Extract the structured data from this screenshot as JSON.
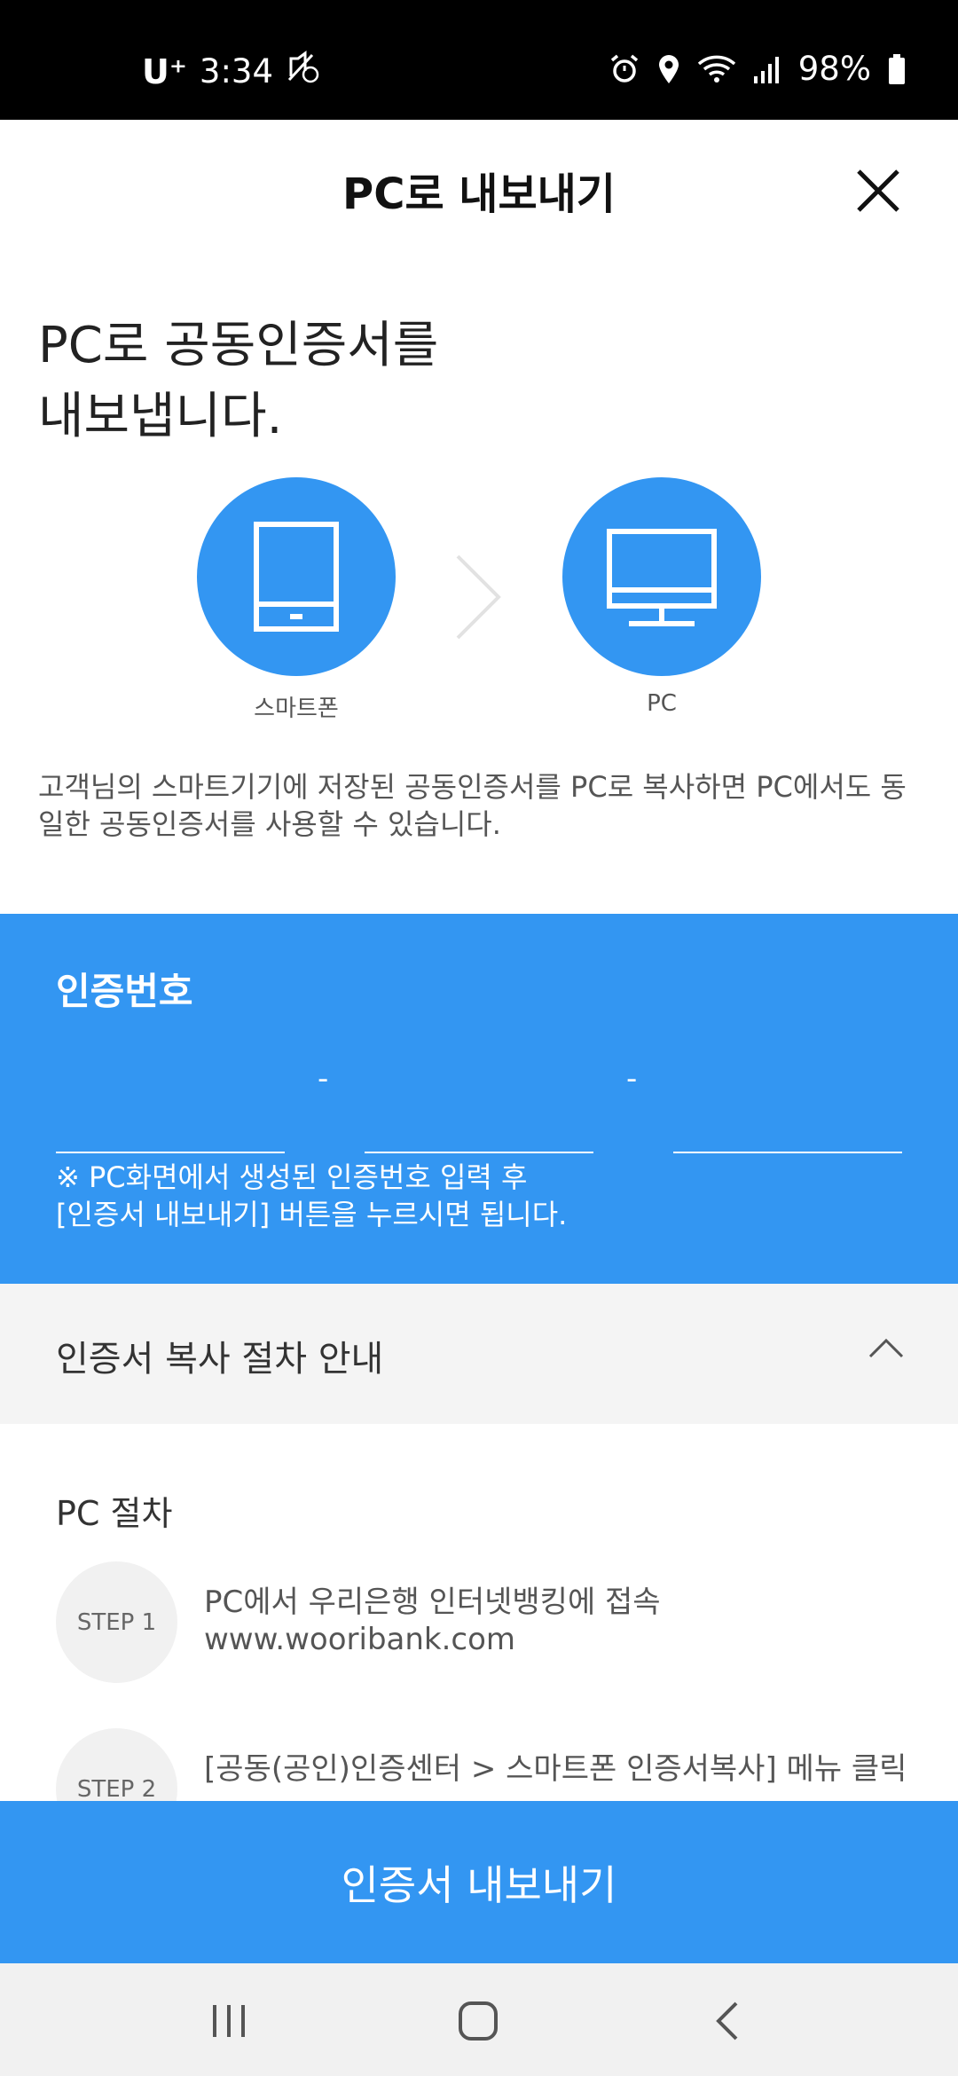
{
  "status_bar": {
    "carrier": "U⁺",
    "time": "3:34",
    "battery": "98%",
    "icons": [
      "no-sound-icon",
      "alarm-icon",
      "location-icon",
      "wifi-icon",
      "signal-icon",
      "battery-icon"
    ]
  },
  "header": {
    "title": "PC로 내보내기",
    "close_icon": "close-icon"
  },
  "intro": {
    "headline": "PC로 공동인증서를\n내보냅니다.",
    "source_label": "스마트폰",
    "target_label": "PC",
    "description": "고객님의 스마트기기에 저장된 공동인증서를 PC로 복사하면 PC에서도 동일한 공동인증서를 사용할 수 있습니다."
  },
  "auth": {
    "title": "인증번호",
    "fields": [
      {
        "value": "",
        "placeholder": ""
      },
      {
        "value": "",
        "placeholder": ""
      },
      {
        "value": "",
        "placeholder": ""
      }
    ],
    "separator": "-",
    "note": "※ PC화면에서 생성된 인증번호 입력 후\n[인증서 내보내기] 버튼을 누르시면 됩니다."
  },
  "guide": {
    "title": "인증서 복사 절차 안내",
    "expanded": true,
    "section_title": "PC 절차",
    "steps": [
      {
        "badge": "STEP 1",
        "text": "PC에서 우리은행 인터넷뱅킹에 접속\nwww.wooribank.com"
      },
      {
        "badge": "STEP 2",
        "text": "[공동(공인)인증센터 > 스마트폰 인증서복사] 메뉴 클릭"
      }
    ]
  },
  "action": {
    "export_label": "인증서 내보내기"
  },
  "colors": {
    "accent": "#3396f2",
    "guide_header_bg": "#f4f4f4",
    "nav_bg": "#f1f1f1"
  }
}
